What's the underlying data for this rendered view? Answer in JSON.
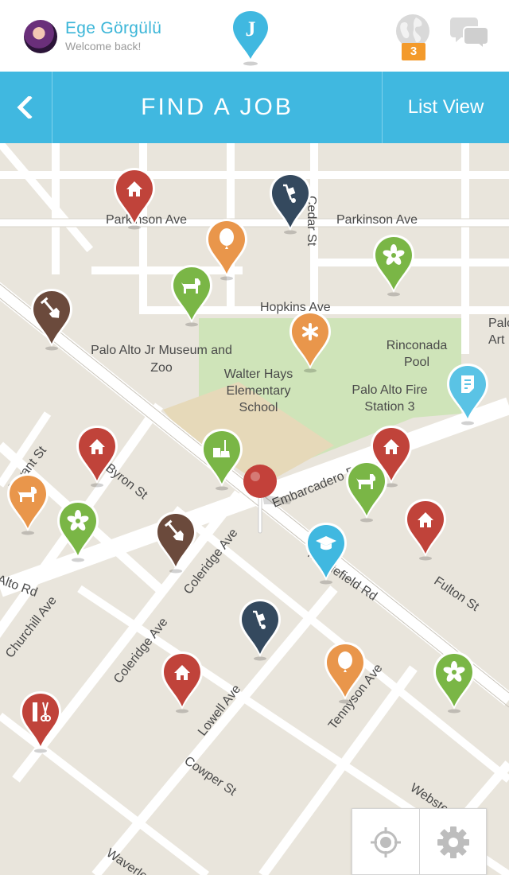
{
  "header": {
    "user_name": "Ege Görgülü",
    "user_subtitle": "Welcome back!",
    "logo_letter": "J",
    "notification_count": "3"
  },
  "titlebar": {
    "back_icon": "chevron-left-icon",
    "title": "FIND A JOB",
    "list_view_label": "List View"
  },
  "map": {
    "street_labels": [
      "Parkinson Ave",
      "Parkinson Ave",
      "Hopkins Ave",
      "Cedar St",
      "Embarcadero Rd",
      "Middlefield Rd",
      "Churchill Ave",
      "Coleridge Ave",
      "Coleridge Ave",
      "Lowell Ave",
      "Cowper St",
      "Tennyson Ave",
      "Fulton St",
      "Webster St",
      "Waverley St",
      "Byron St",
      "Alto Rd",
      "Bryant St"
    ],
    "place_labels": [
      "Palo Alto Jr Museum and Zoo",
      "Walter Hays Elementary School",
      "Rinconada Pool",
      "Palo Alto Fire Station 3",
      "Palo Art"
    ],
    "pins": [
      {
        "category": "house",
        "color": "#c0433a",
        "icon": "house-icon"
      },
      {
        "category": "moving",
        "color": "#34495e",
        "icon": "hand-truck-icon"
      },
      {
        "category": "party",
        "color": "#e9964b",
        "icon": "balloon-icon"
      },
      {
        "category": "pet",
        "color": "#7ab646",
        "icon": "dog-icon"
      },
      {
        "category": "garden",
        "color": "#7ab646",
        "icon": "flower-icon"
      },
      {
        "category": "yard",
        "color": "#6b4a3c",
        "icon": "shovel-icon"
      },
      {
        "category": "medical",
        "color": "#e9964b",
        "icon": "asterisk-icon"
      },
      {
        "category": "writing",
        "color": "#5ac3e5",
        "icon": "document-icon"
      },
      {
        "category": "house",
        "color": "#c0433a",
        "icon": "house-icon"
      },
      {
        "category": "pet",
        "color": "#e9964b",
        "icon": "dog-icon"
      },
      {
        "category": "garden",
        "color": "#7ab646",
        "icon": "flower-icon"
      },
      {
        "category": "cleaning",
        "color": "#7ab646",
        "icon": "cleaning-icon"
      },
      {
        "category": "yard",
        "color": "#6b4a3c",
        "icon": "shovel-icon"
      },
      {
        "category": "house",
        "color": "#c0433a",
        "icon": "house-icon"
      },
      {
        "category": "pet",
        "color": "#7ab646",
        "icon": "dog-icon"
      },
      {
        "category": "house",
        "color": "#c0433a",
        "icon": "house-icon"
      },
      {
        "category": "tutoring",
        "color": "#40b8e0",
        "icon": "graduation-cap-icon"
      },
      {
        "category": "moving",
        "color": "#34495e",
        "icon": "hand-truck-icon"
      },
      {
        "category": "house",
        "color": "#c0433a",
        "icon": "house-icon"
      },
      {
        "category": "party",
        "color": "#e9964b",
        "icon": "balloon-icon"
      },
      {
        "category": "garden",
        "color": "#7ab646",
        "icon": "flower-icon"
      },
      {
        "category": "beauty",
        "color": "#c0433a",
        "icon": "comb-scissors-icon"
      }
    ],
    "current_location_icon": "map-pushpin-icon"
  },
  "controls": {
    "locate_icon": "crosshair-icon",
    "settings_icon": "gear-icon"
  },
  "colors": {
    "accent": "#40b8e0",
    "badge": "#f39a2b",
    "map_bg": "#e9e5dc",
    "park": "#cfe4b9"
  }
}
